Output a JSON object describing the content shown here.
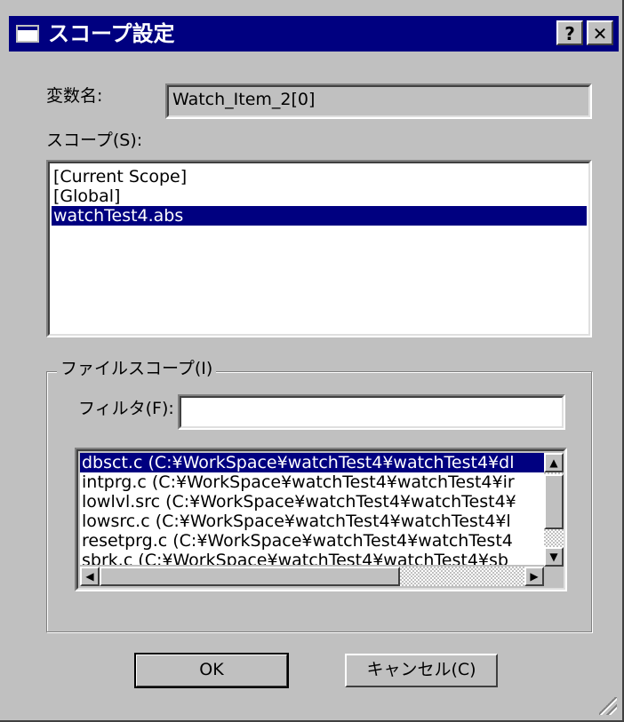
{
  "window": {
    "title": "スコープ設定",
    "help_button": "?",
    "close_button": "✕"
  },
  "variable": {
    "label": "変数名:",
    "value": "Watch_Item_2[0]"
  },
  "scope": {
    "label": "スコープ(S):",
    "items": [
      "[Current Scope]",
      "[Global]",
      "watchTest4.abs"
    ],
    "selected_index": 2
  },
  "file_scope": {
    "group_title": "ファイルスコープ(I)",
    "filter_label": "フィルタ(F):",
    "filter_value": "",
    "items": [
      "dbsct.c (C:¥WorkSpace¥watchTest4¥watchTest4¥dl",
      "intprg.c (C:¥WorkSpace¥watchTest4¥watchTest4¥ir",
      "lowlvl.src (C:¥WorkSpace¥watchTest4¥watchTest4¥",
      "lowsrc.c (C:¥WorkSpace¥watchTest4¥watchTest4¥l",
      "resetprg.c (C:¥WorkSpace¥watchTest4¥watchTest4",
      "sbrk.c (C:¥WorkSpace¥watchTest4¥watchTest4¥sb"
    ],
    "selected_index": 0
  },
  "buttons": {
    "ok": "OK",
    "cancel": "キャンセル(C)"
  },
  "icons": {
    "scroll_up": "▲",
    "scroll_down": "▼",
    "scroll_left": "◀",
    "scroll_right": "▶"
  },
  "colors": {
    "face": "#c0c0c0",
    "title_bar": "#000080",
    "selection": "#000080"
  }
}
